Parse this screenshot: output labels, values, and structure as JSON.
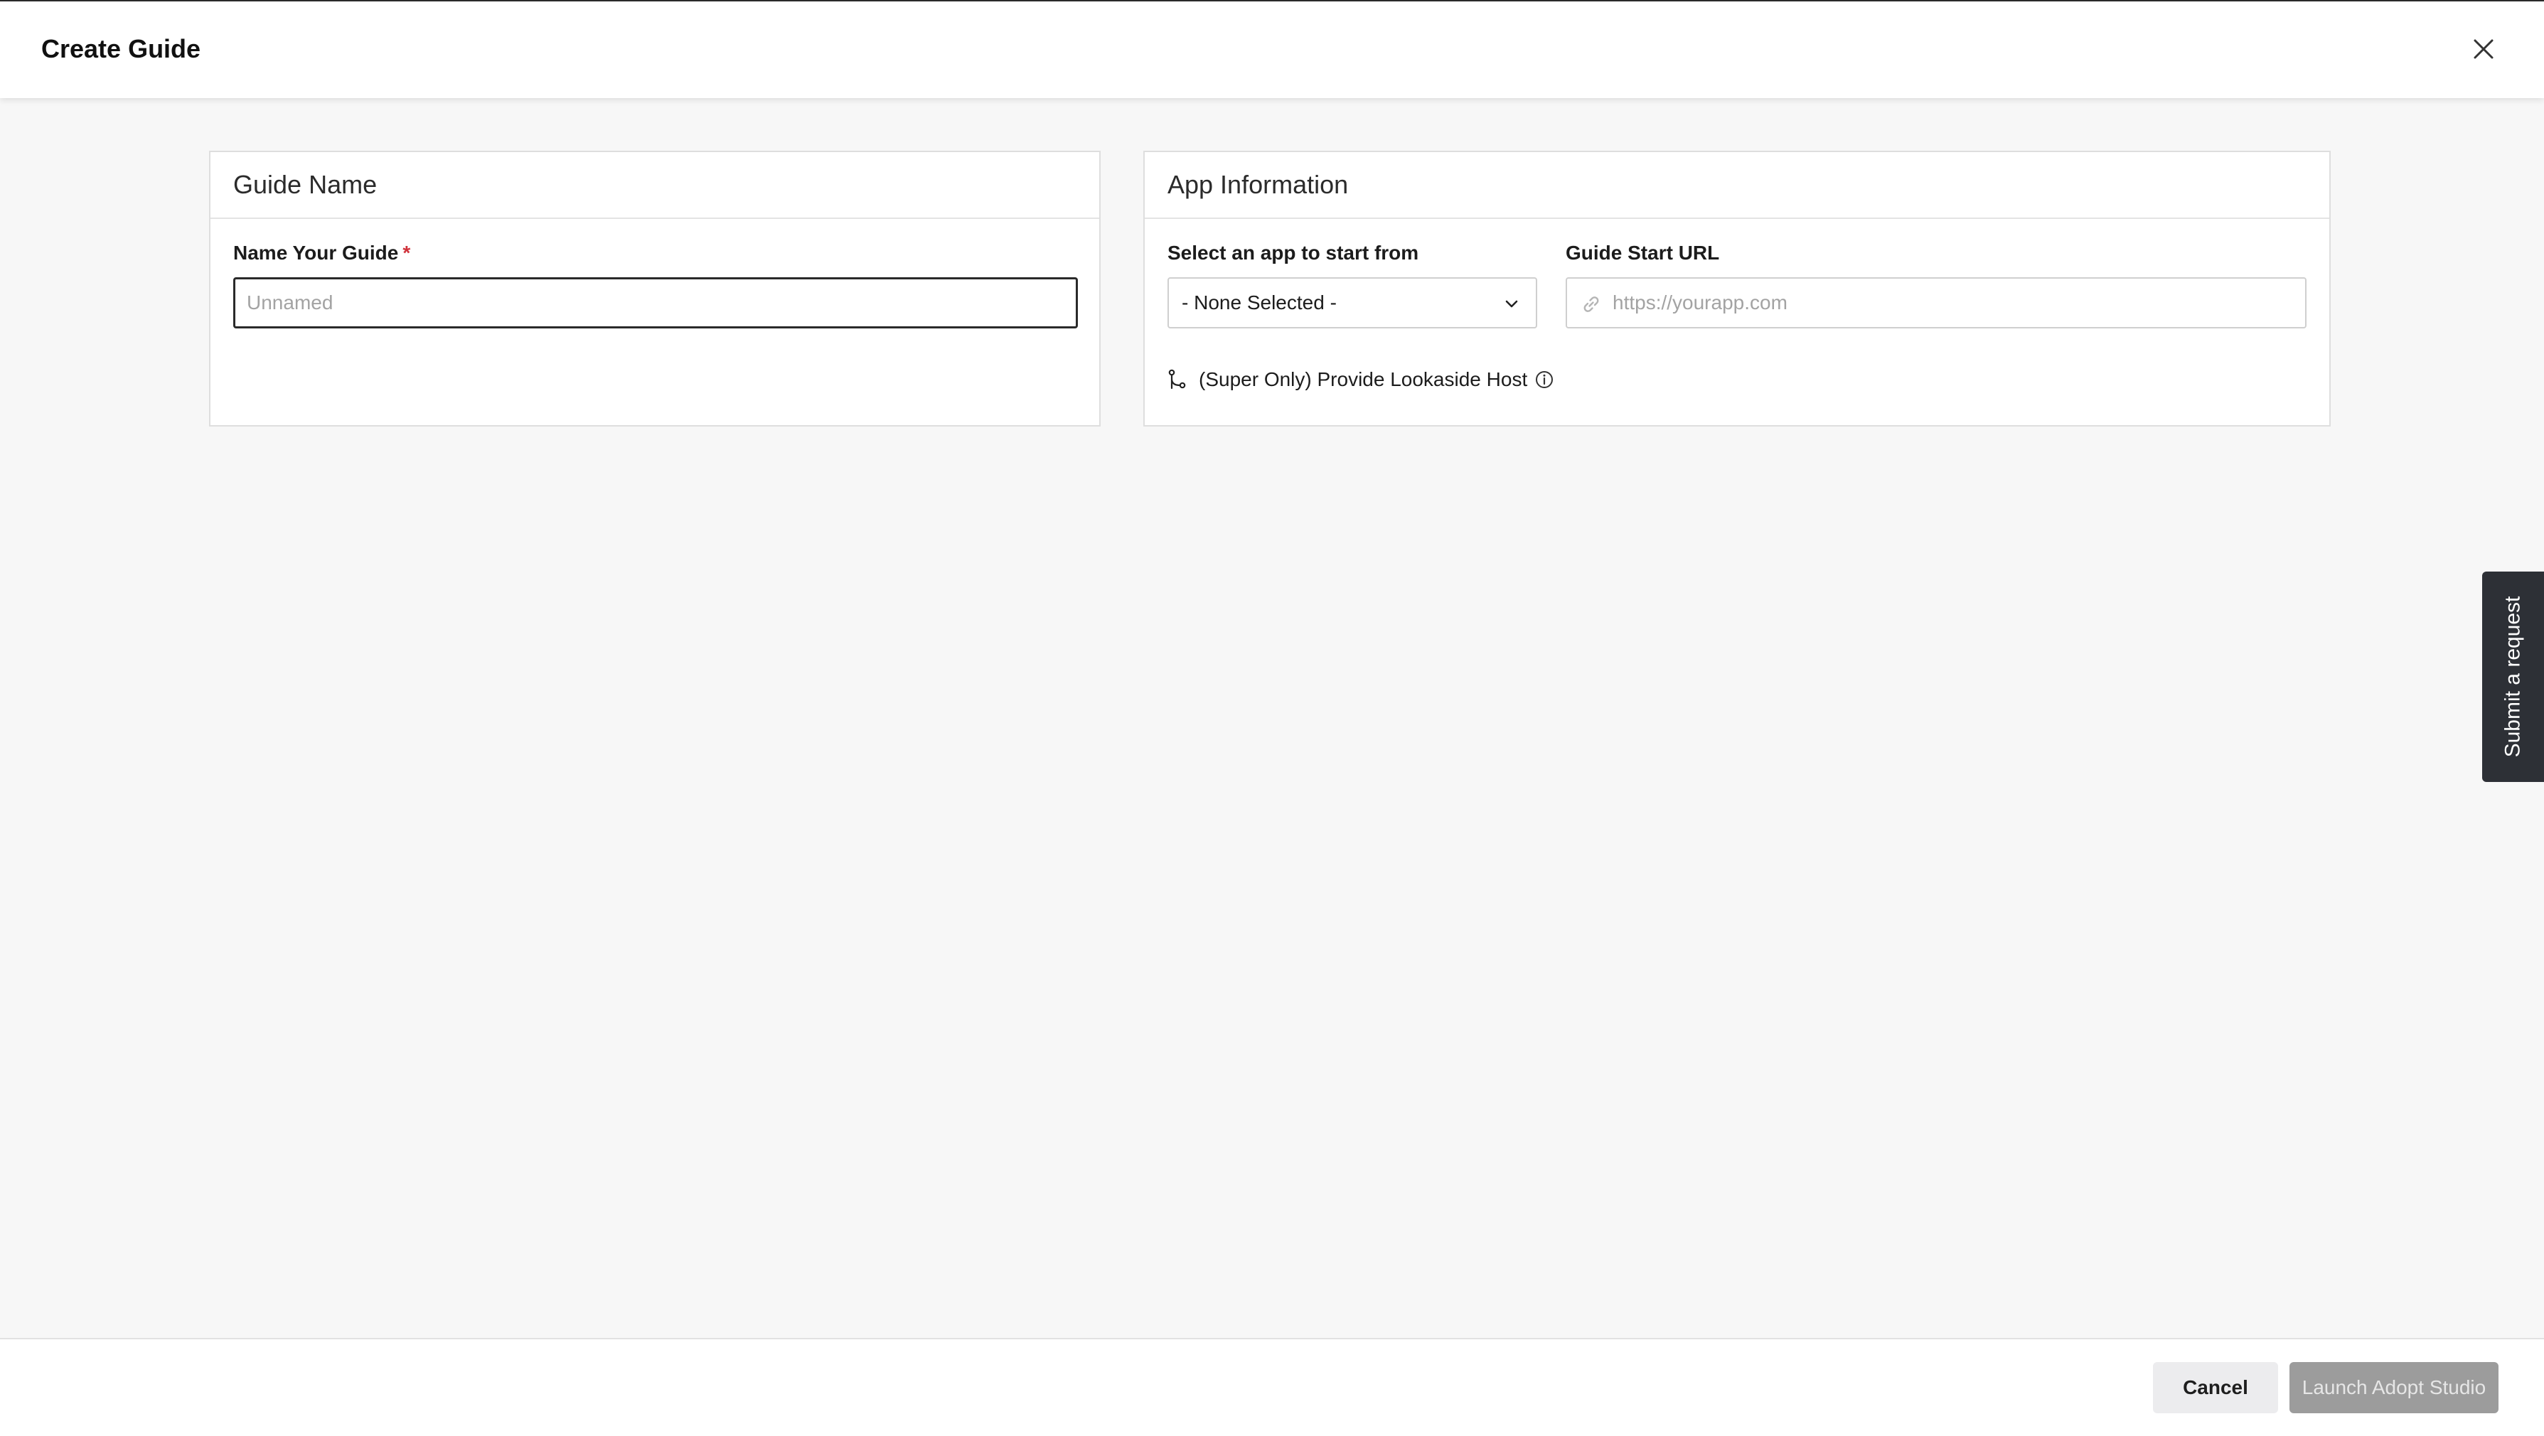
{
  "header": {
    "title": "Create Guide"
  },
  "guide_name_card": {
    "heading": "Guide Name",
    "field_label": "Name Your Guide",
    "required_marker": "*",
    "placeholder": "Unnamed"
  },
  "app_info_card": {
    "heading": "App Information",
    "app_select_label": "Select an app to start from",
    "app_select_value": "- None Selected -",
    "start_url_label": "Guide Start URL",
    "start_url_placeholder": "https://yourapp.com",
    "lookaside_label": "(Super Only) Provide Lookaside Host"
  },
  "side_tab": {
    "label": "Submit a request"
  },
  "footer": {
    "cancel_label": "Cancel",
    "launch_label": "Launch Adopt Studio"
  },
  "colors": {
    "accent_required": "#d0313a",
    "side_tab_bg": "#2d3036",
    "launch_disabled_bg": "#9c9c9c",
    "page_bg": "#f7f7f7"
  },
  "icons": [
    "close-icon",
    "chevron-down-icon",
    "link-icon",
    "branch-icon",
    "info-icon"
  ]
}
